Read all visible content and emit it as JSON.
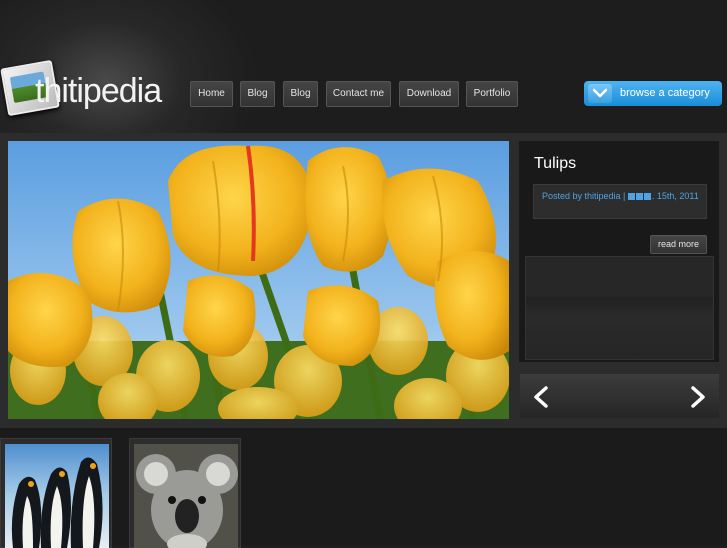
{
  "site": {
    "logo_text": "thitipedia"
  },
  "nav": {
    "items": [
      {
        "label": "Home"
      },
      {
        "label": "Blog"
      },
      {
        "label": "Blog"
      },
      {
        "label": "Contact me"
      },
      {
        "label": "Download"
      },
      {
        "label": "Portfolio"
      }
    ]
  },
  "browse": {
    "label": "browse a category",
    "icon": "chevron-down-icon"
  },
  "featured": {
    "title": "Tulips",
    "meta_prefix": "Posted by thitipedia |",
    "meta_suffix": ". 15th, 2011",
    "read_more": "read more",
    "image": "yellow-tulips-photo"
  },
  "slider": {
    "prev_icon": "arrow-left-icon",
    "next_icon": "arrow-right-icon"
  },
  "thumbnails": [
    {
      "image": "penguins-photo"
    },
    {
      "image": "koala-photo"
    }
  ],
  "colors": {
    "background": "#1e1e1e",
    "accent_blue": "#1a8ed8",
    "meta_link": "#4fa3e4"
  }
}
